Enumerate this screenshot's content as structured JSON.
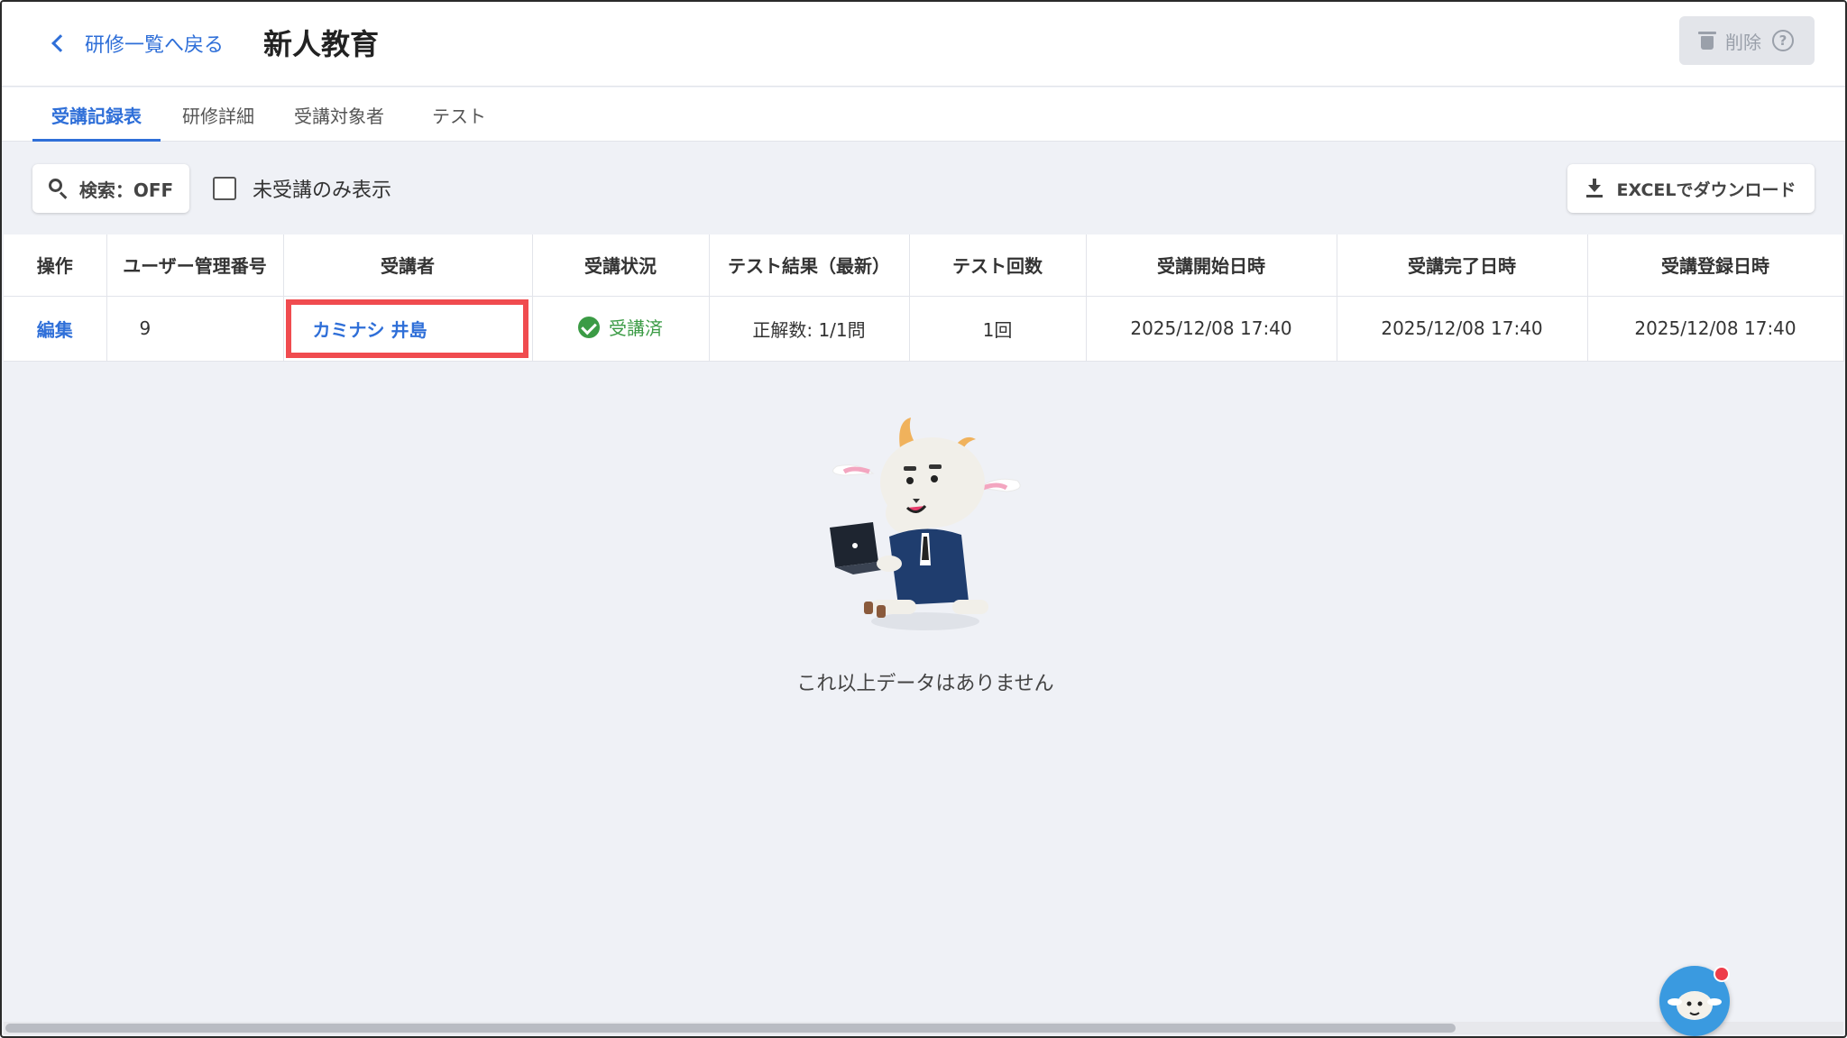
{
  "header": {
    "back_label": "研修一覧へ戻る",
    "title": "新人教育",
    "delete_label": "削除",
    "help_glyph": "?"
  },
  "tabs": [
    {
      "label": "受講記録表",
      "active": true
    },
    {
      "label": "研修詳細",
      "active": false
    },
    {
      "label": "受講対象者",
      "active": false
    },
    {
      "label": "テスト",
      "active": false
    }
  ],
  "toolbar": {
    "search_label": "検索：OFF",
    "checkbox_label": "未受講のみ表示",
    "checkbox_checked": false,
    "excel_label": "EXCELでダウンロード"
  },
  "table": {
    "headers": [
      "操作",
      "ユーザー管理番号",
      "受講者",
      "受講状況",
      "テスト結果（最新）",
      "テスト回数",
      "受講開始日時",
      "受講完了日時",
      "受講登録日時"
    ],
    "rows": [
      {
        "action": "編集",
        "user_id": "9",
        "name": "カミナシ 井島",
        "status": "受講済",
        "test_result": "正解数: 1/1問",
        "test_count": "1回",
        "start": "2025/12/08 17:40",
        "complete": "2025/12/08 17:40",
        "registered": "2025/12/08 17:40"
      }
    ]
  },
  "empty_state": {
    "text": "これ以上データはありません"
  },
  "colors": {
    "accent": "#2f6fd8",
    "success": "#3b9b45",
    "highlight": "#f04b4f",
    "background": "#eff1f6"
  }
}
